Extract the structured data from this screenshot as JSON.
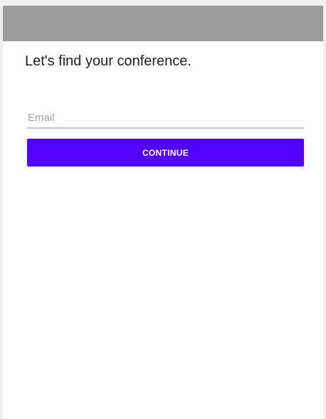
{
  "heading": "Let's find your conference.",
  "email": {
    "value": "",
    "placeholder": "Email"
  },
  "continue_button": {
    "label": "CONTINUE"
  },
  "colors": {
    "accent": "#5200ff",
    "status_bar": "#9c9c9c",
    "background": "#ffffff"
  }
}
